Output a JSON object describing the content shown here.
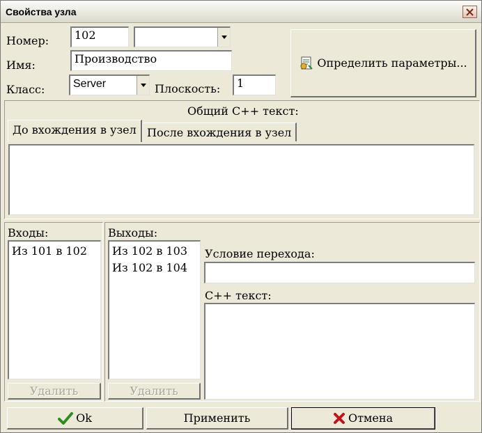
{
  "window": {
    "title": "Свойства узла"
  },
  "fields": {
    "number_label": "Номер:",
    "number_value": "102",
    "number_combo_value": "",
    "name_label": "Имя:",
    "name_value": "Производство",
    "class_label": "Класс:",
    "class_value": "Server",
    "plane_label": "Плоскость:",
    "plane_value": "1"
  },
  "define_params_button": "Определить параметры...",
  "common_cpp": {
    "label": "Общий C++ текст:",
    "tabs": [
      "До вхождения в узел",
      "После вхождения в узел"
    ],
    "active_tab": 0,
    "text": ""
  },
  "inputs": {
    "label": "Входы:",
    "items": [
      "Из 101 в 102"
    ],
    "delete_button": "Удалить"
  },
  "outputs": {
    "label": "Выходы:",
    "items": [
      "Из 102 в 103",
      "Из 102 в 104"
    ],
    "delete_button": "Удалить"
  },
  "transition": {
    "condition_label": "Условие перехода:",
    "condition_value": "",
    "cpp_label": "C++ текст:",
    "cpp_value": ""
  },
  "buttons": {
    "ok": "Ok",
    "apply": "Применить",
    "cancel": "Отмена"
  },
  "colors": {
    "ok_check": "#2e8b1f",
    "cancel_x": "#c0141a",
    "background": "#ece9d8"
  }
}
